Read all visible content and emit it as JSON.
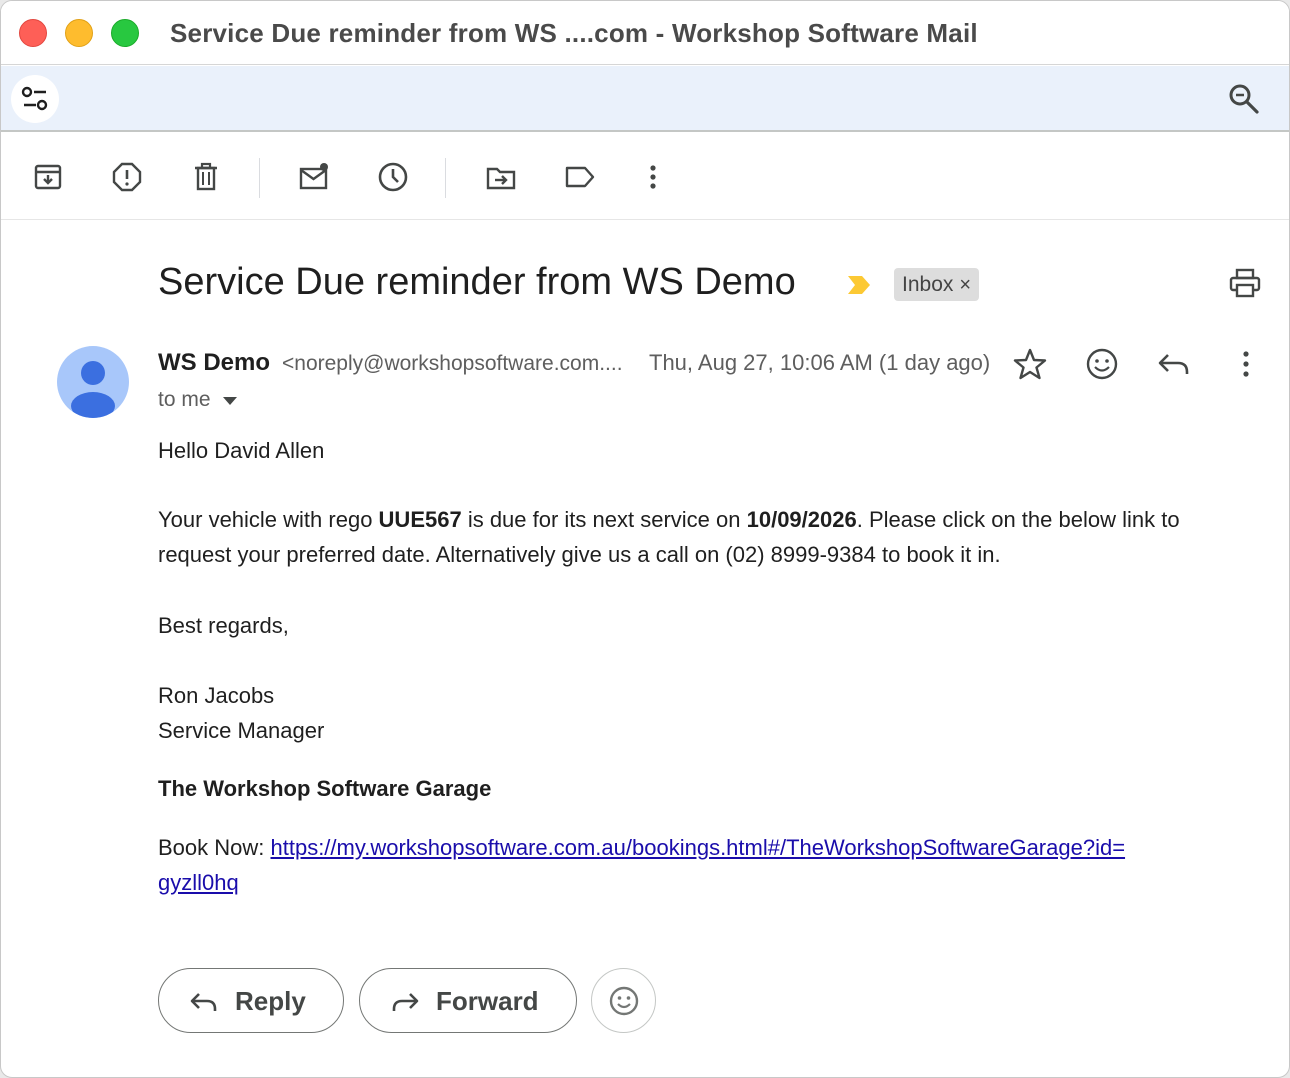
{
  "window": {
    "title": "Service Due reminder from WS ....com - Workshop Software Mail"
  },
  "icons": {
    "filter": "tune-icon",
    "search": "search-icon",
    "archive": "archive-icon",
    "report_spam": "report-spam-icon",
    "delete": "trash-icon",
    "mark_unread": "mark-unread-icon",
    "snooze": "clock-icon",
    "move_to": "move-to-folder-icon",
    "label": "label-icon",
    "more": "more-vert-icon",
    "important": "important-marker-icon",
    "print": "print-icon",
    "star": "star-icon",
    "emoji": "emoji-icon",
    "reply": "reply-icon",
    "forward": "forward-icon"
  },
  "colors": {
    "search_band": "#eaf1fb",
    "important_marker": "#fcc934",
    "avatar_bg": "#a8c7fa",
    "avatar_fg": "#3b6fe0",
    "link": "#1a0dab"
  },
  "message": {
    "subject": "Service Due reminder from WS Demo",
    "label_chip": "Inbox",
    "label_chip_close": "×",
    "sender_name": "WS Demo",
    "sender_email": "<noreply@workshopsoftware.com....",
    "date": "Thu, Aug 27, 10:06 AM (1 day ago)",
    "recipient": "to me"
  },
  "body": {
    "greeting": "Hello David Allen",
    "para1_a": "Your vehicle with rego ",
    "rego": "UUE567",
    "para1_b": " is due for its next service on ",
    "due_date": "10/09/2026",
    "para1_c": ". Please click on the below link to",
    "para1_line2": "request your preferred date. Alternatively give us a call on (02) 8999-9384 to book it in.",
    "signoff": "Best regards,",
    "signer_name": "Ron Jacobs",
    "signer_title": "Service Manager",
    "company": "The Workshop Software Garage",
    "book_label": "Book Now: ",
    "book_link_line1": "https://my.workshopsoftware.com.au/bookings.html#/TheWorkshopSoftwareGarage?id=",
    "book_link_line2": "gyzll0hq"
  },
  "actions": {
    "reply_label": "Reply",
    "forward_label": "Forward"
  }
}
